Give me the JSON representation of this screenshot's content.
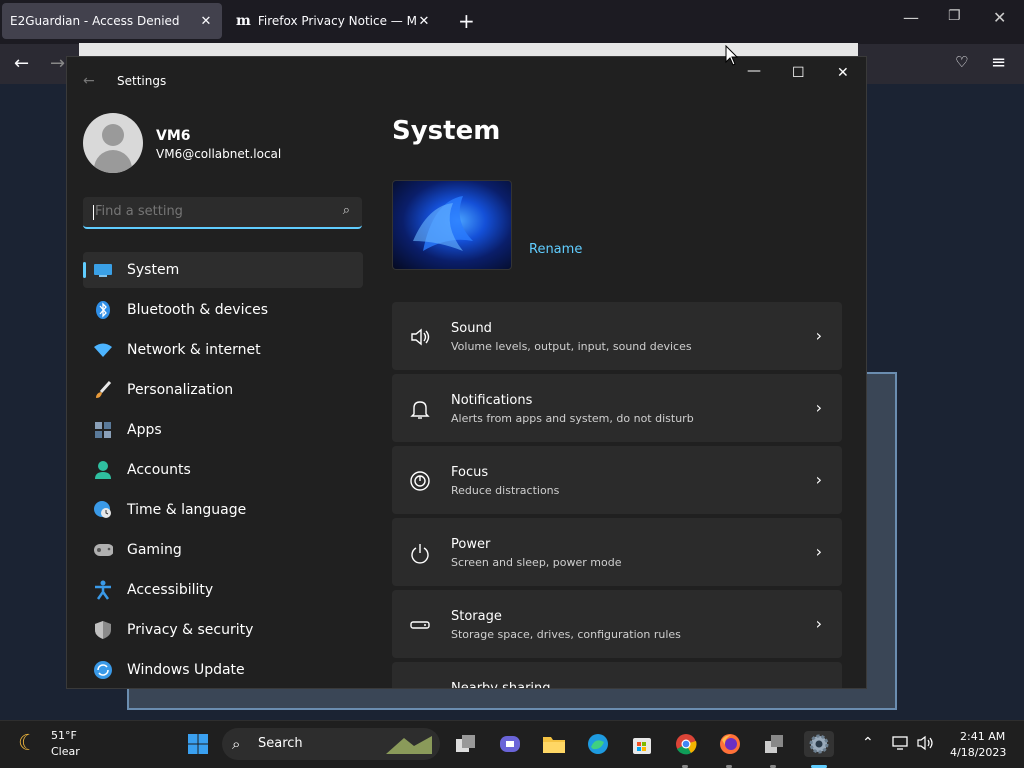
{
  "browser": {
    "tabs": [
      {
        "title": "E2Guardian - Access Denied"
      },
      {
        "title": "Firefox Privacy Notice — Mozill"
      }
    ]
  },
  "settings": {
    "window_title": "Settings",
    "user": {
      "name": "VM6",
      "email": "VM6@collabnet.local"
    },
    "search_placeholder": "Find a setting",
    "nav": [
      {
        "label": "System",
        "icon": "monitor-icon",
        "color": "#3aa0e6"
      },
      {
        "label": "Bluetooth & devices",
        "icon": "bluetooth-icon",
        "color": "#2f8fe8"
      },
      {
        "label": "Network & internet",
        "icon": "wifi-icon",
        "color": "#4cb4ff"
      },
      {
        "label": "Personalization",
        "icon": "brush-icon",
        "color": "#e89a3a"
      },
      {
        "label": "Apps",
        "icon": "apps-icon",
        "color": "#8aa0b8"
      },
      {
        "label": "Accounts",
        "icon": "person-icon",
        "color": "#2fbfa0"
      },
      {
        "label": "Time & language",
        "icon": "globe-clock-icon",
        "color": "#3a9ae8"
      },
      {
        "label": "Gaming",
        "icon": "gamepad-icon",
        "color": "#b0b0b0"
      },
      {
        "label": "Accessibility",
        "icon": "accessibility-icon",
        "color": "#3a9ae8"
      },
      {
        "label": "Privacy & security",
        "icon": "shield-icon",
        "color": "#8a8a8a"
      },
      {
        "label": "Windows Update",
        "icon": "update-icon",
        "color": "#3a9ae8"
      }
    ],
    "page_title": "System",
    "rename_label": "Rename",
    "cards": [
      {
        "title": "Sound",
        "subtitle": "Volume levels, output, input, sound devices",
        "icon": "speaker-icon"
      },
      {
        "title": "Notifications",
        "subtitle": "Alerts from apps and system, do not disturb",
        "icon": "bell-icon"
      },
      {
        "title": "Focus",
        "subtitle": "Reduce distractions",
        "icon": "focus-icon"
      },
      {
        "title": "Power",
        "subtitle": "Screen and sleep, power mode",
        "icon": "power-icon"
      },
      {
        "title": "Storage",
        "subtitle": "Storage space, drives, configuration rules",
        "icon": "storage-icon"
      },
      {
        "title": "Nearby sharing",
        "subtitle": "",
        "icon": "share-icon"
      }
    ]
  },
  "taskbar": {
    "weather": {
      "temp": "51°F",
      "condition": "Clear"
    },
    "search_label": "Search",
    "time": "2:41 AM",
    "date": "4/18/2023"
  }
}
